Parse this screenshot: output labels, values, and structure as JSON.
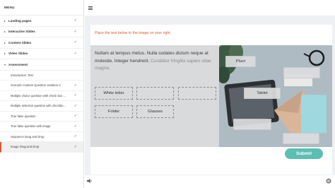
{
  "sidebar": {
    "header": "MENU",
    "sections": [
      {
        "label": "Landing pages",
        "checked": true
      },
      {
        "label": "Interactive Slides",
        "checked": true
      },
      {
        "label": "Content Slides",
        "checked": true
      },
      {
        "label": "Video Slides",
        "checked": true
      },
      {
        "label": "Assessment",
        "checked": false
      }
    ],
    "items": [
      {
        "label": "Introduction: Test",
        "checked": false
      },
      {
        "label": "Scenario Custom Question variation C",
        "checked": true
      },
      {
        "label": "Multiple choice question with check box ...",
        "checked": true
      },
      {
        "label": "Multiple selection question with checkbo...",
        "checked": true
      },
      {
        "label": "True false question",
        "checked": true
      },
      {
        "label": "True false question with image",
        "checked": true
      },
      {
        "label": "Sequence Drag and Drop",
        "checked": true
      },
      {
        "label": "Image Drag and Drop",
        "checked": true
      }
    ]
  },
  "question": {
    "instruction": "Place the text below to the image on your right.",
    "text_main": "Nullam at tempus metus. Nulla sodales dictum neque at molestie. Integer hendrerit.",
    "text_faded": "Curabitur fringilla sapien vitae magna.",
    "source_slots": [
      "White letter",
      "",
      "",
      "Folder",
      "Glasses"
    ],
    "drop_zones": [
      "Plant",
      "",
      "Tablet",
      "",
      ""
    ],
    "submit_label": "Submit"
  },
  "colors": {
    "accent": "#e6572e",
    "submit": "#5bbfb3",
    "panel": "#d9dadc"
  }
}
